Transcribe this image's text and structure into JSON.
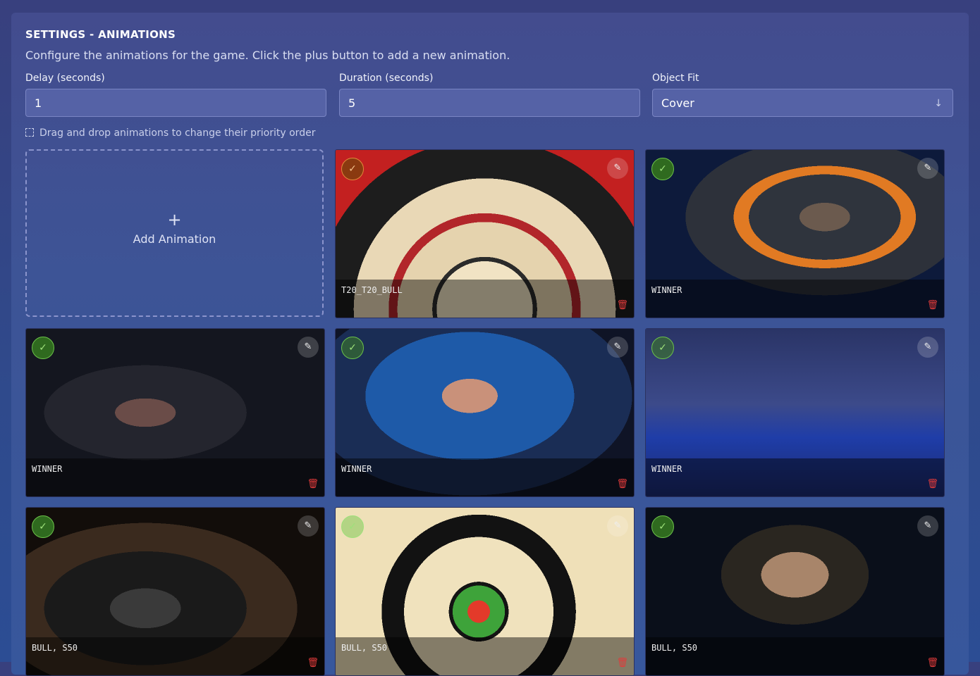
{
  "header": {
    "title": "SETTINGS - ANIMATIONS",
    "description": "Configure the animations for the game. Click the plus button to add a new animation."
  },
  "fields": {
    "delay": {
      "label": "Delay (seconds)",
      "value": "1"
    },
    "duration": {
      "label": "Duration (seconds)",
      "value": "5"
    },
    "object_fit": {
      "label": "Object Fit",
      "value": "Cover"
    }
  },
  "hint": "Drag and drop animations to change their priority order",
  "add_card": {
    "plus": "+",
    "label": "Add Animation"
  },
  "icons": {
    "check": "check-icon",
    "edit": "pencil-icon",
    "delete": "trash-icon",
    "drag": "drag-icon",
    "select": "arrow-down-icon"
  },
  "glyphs": {
    "check": "✓",
    "edit": "✎",
    "trash": "🗑",
    "arrow": "↓"
  },
  "animations": [
    {
      "tag": "T20_T20_BULL",
      "active": true
    },
    {
      "tag": "WINNER",
      "active": true
    },
    {
      "tag": "WINNER",
      "active": true
    },
    {
      "tag": "WINNER",
      "active": true
    },
    {
      "tag": "WINNER",
      "active": true
    },
    {
      "tag": "BULL, S50",
      "active": true
    },
    {
      "tag": "BULL, S50",
      "active": true
    },
    {
      "tag": "BULL, S50",
      "active": true
    }
  ]
}
